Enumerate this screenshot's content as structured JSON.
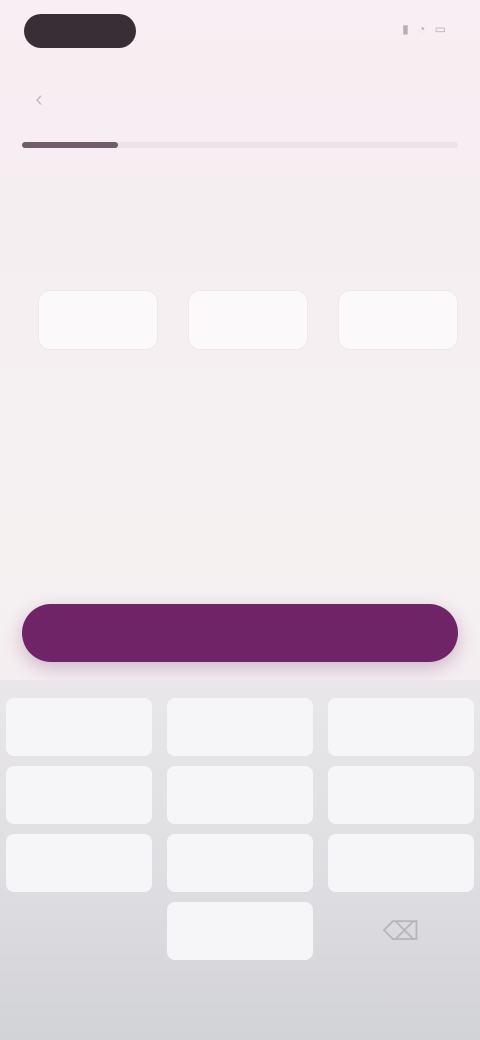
{
  "status_bar": {
    "time": "",
    "icons": [
      "signal-icon",
      "wifi-icon",
      "battery-icon"
    ]
  },
  "header": {
    "title": ""
  },
  "progress": {
    "value": 0.22
  },
  "content": {
    "heading": "",
    "subtext": ""
  },
  "code_fields": [
    {
      "value": ""
    },
    {
      "value": ""
    },
    {
      "value": ""
    }
  ],
  "actions": {
    "continue_label": ""
  },
  "keyboard": {
    "keys": [
      "",
      "",
      "",
      "",
      "",
      "",
      "",
      "",
      "",
      "",
      "",
      ""
    ],
    "backspace_icon": "backspace-icon"
  },
  "colors": {
    "accent": "#6e2466",
    "background": "#f5eef1",
    "keyboard": "#dddce0"
  }
}
